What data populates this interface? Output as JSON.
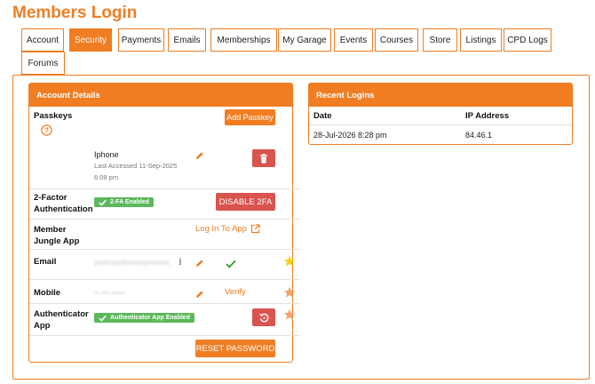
{
  "page": {
    "title": "Members Login"
  },
  "tabs": [
    {
      "label": "Account",
      "active": false
    },
    {
      "label": "Security",
      "active": true
    },
    {
      "label": "Payments",
      "active": false
    },
    {
      "label": "Emails",
      "active": false
    },
    {
      "label": "Memberships",
      "active": false
    },
    {
      "label": "My Garage",
      "active": false
    },
    {
      "label": "Events",
      "active": false
    },
    {
      "label": "Courses",
      "active": false
    },
    {
      "label": "Store",
      "active": false
    },
    {
      "label": "Listings",
      "active": false
    },
    {
      "label": "CPD Logs",
      "active": false
    },
    {
      "label": "Forums",
      "active": false
    }
  ],
  "account_details": {
    "title": "Account Details",
    "passkeys": {
      "label": "Passkeys",
      "add_label": "Add Passkey",
      "device_name": "Iphone",
      "last_accessed": "Last Accessed 11-Sep-2025",
      "last_accessed_time": "6:09 pm"
    },
    "two_factor": {
      "label_line1": "2-Factor",
      "label_line2": "Authentication",
      "badge": "2-FA Enabled",
      "disable_label": "DISABLE 2FA"
    },
    "member_app": {
      "label_line1": "Member",
      "label_line2": "Jungle App",
      "link": "Log In To App"
    },
    "email": {
      "label": "Email",
      "value_blurred": "pxdx•pxdevelopment•c",
      "value_end": "j"
    },
    "mobile": {
      "label": "Mobile",
      "value_blurred": "•• ••• •••••",
      "verify": "Verify"
    },
    "authenticator": {
      "label_line1": "Authenticator",
      "label_line2": "App",
      "badge": "Authenticator App Enabled"
    },
    "reset_label": "RESET PASSWORD"
  },
  "recent_logins": {
    "title": "Recent Logins",
    "columns": [
      "Date",
      "IP Address"
    ],
    "rows": [
      {
        "date": "28-Jul-2026 8:28 pm",
        "ip": "84.46.1"
      }
    ]
  },
  "colors": {
    "accent": "#f07d22",
    "danger": "#d9534f",
    "success": "#5cb85c",
    "star": "#f6d21c"
  }
}
